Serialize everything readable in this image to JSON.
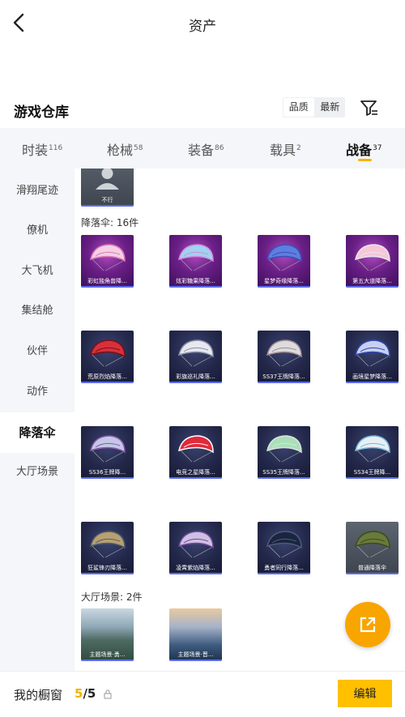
{
  "header": {
    "title": "资产"
  },
  "warehouse": {
    "title": "游戏仓库",
    "sort": [
      "品质",
      "最新"
    ]
  },
  "tabs": [
    {
      "label": "时装",
      "count": "116"
    },
    {
      "label": "枪械",
      "count": "58"
    },
    {
      "label": "装备",
      "count": "86"
    },
    {
      "label": "载具",
      "count": "2"
    },
    {
      "label": "战备",
      "count": "37"
    }
  ],
  "sidebar": [
    "滑翔尾迹",
    "僚机",
    "大飞机",
    "集结舱",
    "伙伴",
    "动作",
    "降落伞",
    "大厅场景"
  ],
  "top_item": {
    "caption": "不行"
  },
  "parachute": {
    "heading": "降落伞: 16件",
    "items": [
      "彩虹独角兽降...",
      "炫彩糖果降落...",
      "星梦奇缘降落...",
      "第五大道降落...",
      "荒原烈焰降落...",
      "彩旗巡礼降落...",
      "SS37王牌降落...",
      "画境星梦降落...",
      "SS36王牌降...",
      "电竞之星降落...",
      "SS35王牌降落...",
      "SS34王牌降...",
      "狂鲨锋刃降落...",
      "凌霄紫焰降落...",
      "勇者同行降落...",
      "普通降落伞"
    ]
  },
  "lobby": {
    "heading": "大厅场景: 2件",
    "items": [
      "主题场景·勇...",
      "主题场景·晋..."
    ]
  },
  "bottom": {
    "label": "我的橱窗",
    "current": "5",
    "total": "/5",
    "edit": "编辑"
  },
  "colors": {
    "accent": "#ffc000",
    "tab_underline": "#f7b400",
    "fab": "#f8a500",
    "card_bar": "#5b6cf0"
  }
}
